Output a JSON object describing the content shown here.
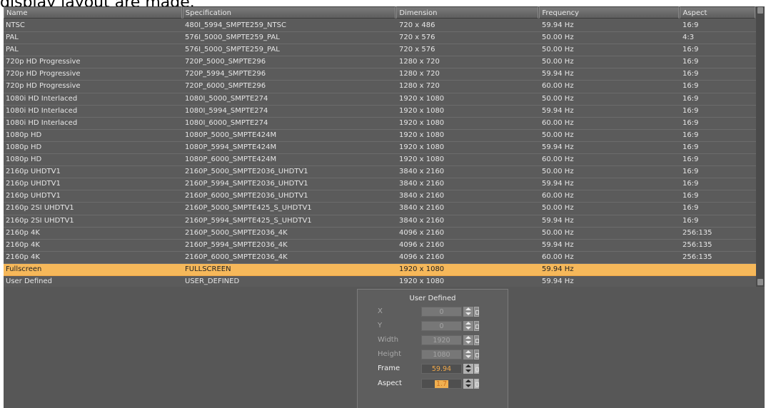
{
  "caption": "display layout are made.",
  "table": {
    "columns": [
      "Name",
      "Specification",
      "Dimension",
      "Frequency",
      "Aspect"
    ],
    "rows": [
      [
        "NTSC",
        "480I_5994_SMPTE259_NTSC",
        "720 x 486",
        "59.94 Hz",
        "16:9"
      ],
      [
        "PAL",
        "576I_5000_SMPTE259_PAL",
        "720 x 576",
        "50.00 Hz",
        "4:3"
      ],
      [
        "PAL",
        "576I_5000_SMPTE259_PAL",
        "720 x 576",
        "50.00 Hz",
        "16:9"
      ],
      [
        "720p HD Progressive",
        "720P_5000_SMPTE296",
        "1280 x 720",
        "50.00 Hz",
        "16:9"
      ],
      [
        "720p HD Progressive",
        "720P_5994_SMPTE296",
        "1280 x 720",
        "59.94 Hz",
        "16:9"
      ],
      [
        "720p HD Progressive",
        "720P_6000_SMPTE296",
        "1280 x 720",
        "60.00 Hz",
        "16:9"
      ],
      [
        "1080i HD Interlaced",
        "1080I_5000_SMPTE274",
        "1920 x 1080",
        "50.00 Hz",
        "16:9"
      ],
      [
        "1080i HD Interlaced",
        "1080I_5994_SMPTE274",
        "1920 x 1080",
        "59.94 Hz",
        "16:9"
      ],
      [
        "1080i HD Interlaced",
        "1080I_6000_SMPTE274",
        "1920 x 1080",
        "60.00 Hz",
        "16:9"
      ],
      [
        "1080p HD",
        "1080P_5000_SMPTE424M",
        "1920 x 1080",
        "50.00 Hz",
        "16:9"
      ],
      [
        "1080p HD",
        "1080P_5994_SMPTE424M",
        "1920 x 1080",
        "59.94 Hz",
        "16:9"
      ],
      [
        "1080p HD",
        "1080P_6000_SMPTE424M",
        "1920 x 1080",
        "60.00 Hz",
        "16:9"
      ],
      [
        "2160p UHDTV1",
        "2160P_5000_SMPTE2036_UHDTV1",
        "3840 x 2160",
        "50.00 Hz",
        "16:9"
      ],
      [
        "2160p UHDTV1",
        "2160P_5994_SMPTE2036_UHDTV1",
        "3840 x 2160",
        "59.94 Hz",
        "16:9"
      ],
      [
        "2160p UHDTV1",
        "2160P_6000_SMPTE2036_UHDTV1",
        "3840 x 2160",
        "60.00 Hz",
        "16:9"
      ],
      [
        "2160p 2SI UHDTV1",
        "2160P_5000_SMPTE425_S_UHDTV1",
        "3840 x 2160",
        "50.00 Hz",
        "16:9"
      ],
      [
        "2160p 2SI UHDTV1",
        "2160P_5994_SMPTE425_S_UHDTV1",
        "3840 x 2160",
        "59.94 Hz",
        "16:9"
      ],
      [
        "2160p 4K",
        "2160P_5000_SMPTE2036_4K",
        "4096 x 2160",
        "50.00 Hz",
        "256:135"
      ],
      [
        "2160p 4K",
        "2160P_5994_SMPTE2036_4K",
        "4096 x 2160",
        "59.94 Hz",
        "256:135"
      ],
      [
        "2160p 4K",
        "2160P_6000_SMPTE2036_4K",
        "4096 x 2160",
        "60.00 Hz",
        "256:135"
      ],
      [
        "Fullscreen",
        "FULLSCREEN",
        "1920 x 1080",
        "59.94 Hz",
        ""
      ],
      [
        "User Defined",
        "USER_DEFINED",
        "1920 x 1080",
        "59.94 Hz",
        ""
      ]
    ],
    "selected_row": 20
  },
  "panel": {
    "title": "User Defined",
    "fields": [
      {
        "label": "X",
        "value": "0",
        "enabled": false
      },
      {
        "label": "Y",
        "value": "0",
        "enabled": false
      },
      {
        "label": "Width",
        "value": "1920",
        "enabled": false
      },
      {
        "label": "Height",
        "value": "1080",
        "enabled": false
      },
      {
        "label": "Frame",
        "value": "59.94",
        "enabled": true
      },
      {
        "label": "Aspect",
        "value": "1.7",
        "enabled": true
      }
    ]
  },
  "colors": {
    "selection": "#f6b85a",
    "accent_value": "#f0a84a",
    "background": "#5a5a5a"
  }
}
